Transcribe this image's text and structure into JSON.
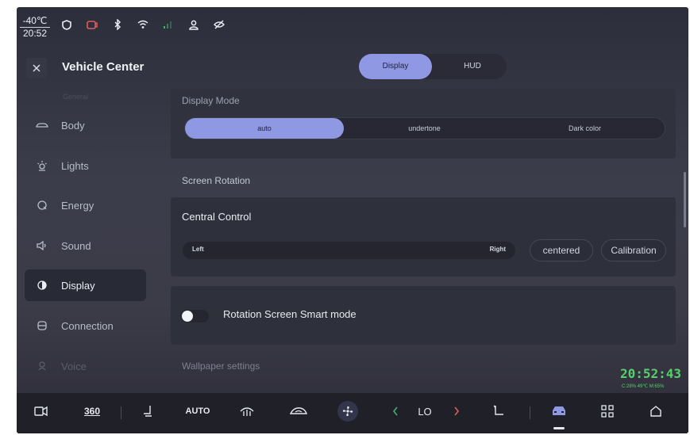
{
  "status_bar": {
    "temperature": "-40℃",
    "time": "20:52",
    "icons": [
      "shield-icon",
      "camera-icon",
      "bluetooth-icon",
      "wifi-icon",
      "signal-icon",
      "user-icon",
      "eye-off-icon"
    ]
  },
  "header": {
    "title": "Vehicle Center",
    "close_icon": "close-icon"
  },
  "tabs": [
    {
      "label": "Display",
      "active": true
    },
    {
      "label": "HUD",
      "active": false
    }
  ],
  "sidebar": {
    "faded_top": "General",
    "items": [
      {
        "label": "Body",
        "icon": "car-icon",
        "active": false
      },
      {
        "label": "Lights",
        "icon": "light-icon",
        "active": false
      },
      {
        "label": "Energy",
        "icon": "energy-icon",
        "active": false
      },
      {
        "label": "Sound",
        "icon": "speaker-icon",
        "active": false
      },
      {
        "label": "Display",
        "icon": "display-icon",
        "active": true
      },
      {
        "label": "Connection",
        "icon": "connection-icon",
        "active": false
      },
      {
        "label": "Voice",
        "icon": "voice-icon",
        "active": false
      }
    ]
  },
  "display_mode": {
    "label": "Display Mode",
    "options": [
      "auto",
      "undertone",
      "Dark color"
    ],
    "selected": "auto"
  },
  "screen_rotation": {
    "label": "Screen Rotation",
    "central_control": "Central Control",
    "slider_left": "Left",
    "slider_right": "Right",
    "centered_button": "centered",
    "calibration_button": "Calibration"
  },
  "smart_mode": {
    "label": "Rotation Screen Smart mode",
    "enabled": false
  },
  "wallpaper": {
    "label": "Wallpaper settings"
  },
  "clock_overlay": {
    "time": "20:52:43",
    "sub": "C:28% 49℃ M:65%"
  },
  "dock": {
    "items": [
      {
        "icon": "back-camera-icon"
      },
      {
        "label": "360"
      },
      {
        "icon": "seat-recline-icon"
      },
      {
        "label": "AUTO"
      },
      {
        "icon": "defrost-icon"
      },
      {
        "icon": "recirculation-icon"
      },
      {
        "icon": "fan-icon"
      },
      {
        "icon": "chevron-left-icon"
      },
      {
        "label": "LO"
      },
      {
        "icon": "chevron-right-icon"
      },
      {
        "icon": "seat-icon"
      },
      {
        "icon": "car-front-icon",
        "active": true
      },
      {
        "icon": "apps-grid-icon"
      },
      {
        "icon": "home-icon"
      }
    ]
  },
  "colors": {
    "accent": "#8f98e3",
    "clock_green": "#56d06a",
    "active_red": "#e25b5b",
    "active_green": "#3fb36c"
  }
}
